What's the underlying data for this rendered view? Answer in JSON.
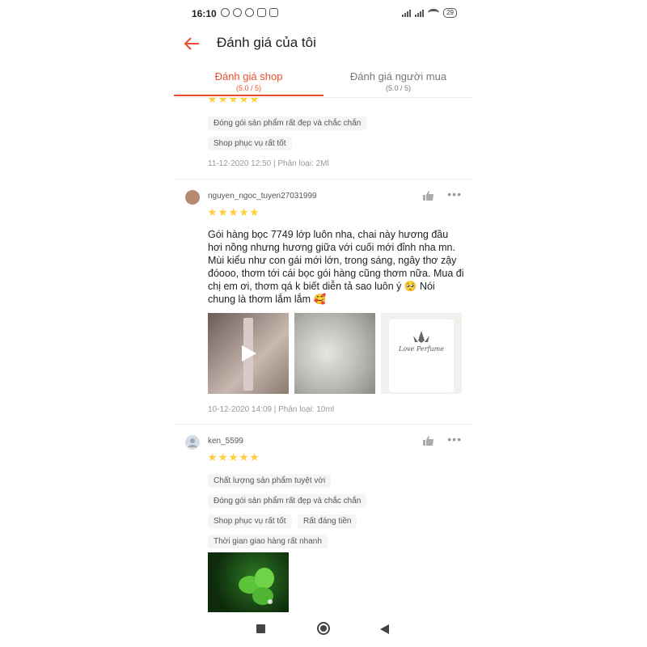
{
  "status_bar": {
    "time": "16:10",
    "battery": "29"
  },
  "header": {
    "title": "Đánh giá của tôi"
  },
  "tabs": [
    {
      "label": "Đánh giá shop",
      "sub": "(5.0 / 5)"
    },
    {
      "label": "Đánh giá người mua",
      "sub": "(5.0 / 5)"
    }
  ],
  "colors": {
    "accent": "#ee4d2d",
    "star": "#ffce3d"
  },
  "reviews": [
    {
      "rating": 5,
      "tags": [
        "Đóng gói sản phẩm rất đẹp và chắc chắn",
        "Shop phục vụ rất tốt"
      ],
      "meta": "11-12-2020 12:50 | Phân loại: 2Ml"
    },
    {
      "username": "nguyen_ngoc_tuyen27031999",
      "rating": 5,
      "text": "Gói hàng bọc 7749 lớp luôn nha, chai này hương đầu hơi nồng nhưng hương giữa với cuối mới đỉnh nha mn. Mùi kiểu như con gái mới lớn, trong sáng, ngây thơ zậy đóooo, thơm tới cái bọc gói hàng cũng thơm nữa. Mua đi chị em ơi, thơm qá k biết diễn tả sao luôn ý 🥺 Nói chung là thơm lắm lắm 🥰",
      "photo_brand": "Love Perfume",
      "meta": "10-12-2020 14:09 | Phân loại: 10ml"
    },
    {
      "username": "ken_5599",
      "rating": 5,
      "tags": [
        "Chất lượng sản phẩm tuyệt vời",
        "Đóng gói sản phẩm rất đẹp và chắc chắn",
        "Shop phục vụ rất tốt",
        "Rất đáng tiền",
        "Thời gian giao hàng rất nhanh"
      ]
    }
  ]
}
